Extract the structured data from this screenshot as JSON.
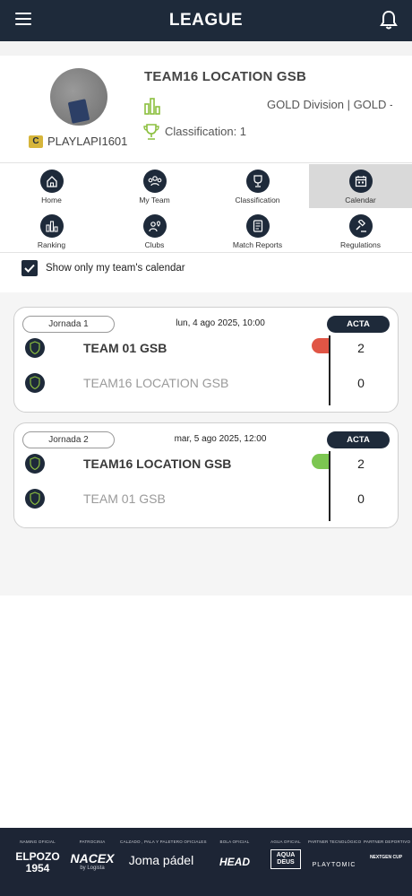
{
  "header": {
    "title": "LEAGUE",
    "menu_icon": "hamburger-menu-icon",
    "notifications_icon": "bell-icon"
  },
  "profile": {
    "team_name": "TEAM16 LOCATION GSB",
    "username": "PLAYLAPI1601",
    "captain_badge": "C",
    "division": "GOLD Division | GOLD - G",
    "classification": "Classification: 1"
  },
  "nav": {
    "items": [
      {
        "label": "Home",
        "icon": "home-icon"
      },
      {
        "label": "My Team",
        "icon": "team-icon"
      },
      {
        "label": "Classification",
        "icon": "trophy-icon"
      },
      {
        "label": "Calendar",
        "icon": "calendar-icon",
        "active": true
      },
      {
        "label": "Ranking",
        "icon": "ranking-icon"
      },
      {
        "label": "Clubs",
        "icon": "clubs-icon"
      },
      {
        "label": "Match Reports",
        "icon": "report-icon"
      },
      {
        "label": "Regulations",
        "icon": "gavel-icon"
      }
    ]
  },
  "filter": {
    "label": "Show only my team's calendar",
    "checked": true
  },
  "matches": [
    {
      "jornada": "Jornada 1",
      "date": "lun, 4 ago 2025, 10:00",
      "acta_label": "ACTA",
      "home": {
        "name": "TEAM 01 GSB",
        "score": "2",
        "winner": true
      },
      "away": {
        "name": "TEAM16 LOCATION GSB",
        "score": "0",
        "winner": false
      },
      "result_color": "#e05545"
    },
    {
      "jornada": "Jornada 2",
      "date": "mar, 5 ago 2025, 12:00",
      "acta_label": "ACTA",
      "home": {
        "name": "TEAM16 LOCATION GSB",
        "score": "2",
        "winner": true
      },
      "away": {
        "name": "TEAM 01 GSB",
        "score": "0",
        "winner": false
      },
      "result_color": "#7cc651"
    }
  ],
  "footer": {
    "sponsors": [
      {
        "caption": "NAMING OFICIAL",
        "name": "ELPOZO 1954"
      },
      {
        "caption": "PATROCINIA",
        "name": "NACEX",
        "sub": "by Logista"
      },
      {
        "caption": "CALZADO , PALA Y PALETERO OFICIALES",
        "name": "Joma pádel"
      },
      {
        "caption": "BOLA OFICIAL",
        "name": "HEAD"
      },
      {
        "caption": "AGUA OFICIAL",
        "name": "AQUA DEUS"
      },
      {
        "caption": "PARTNER TECNOLÓGICO",
        "name": "PLAYTOMIC"
      },
      {
        "caption": "PARTNER DEPORTIVO",
        "name": "NEXTGEN CUP"
      }
    ]
  }
}
